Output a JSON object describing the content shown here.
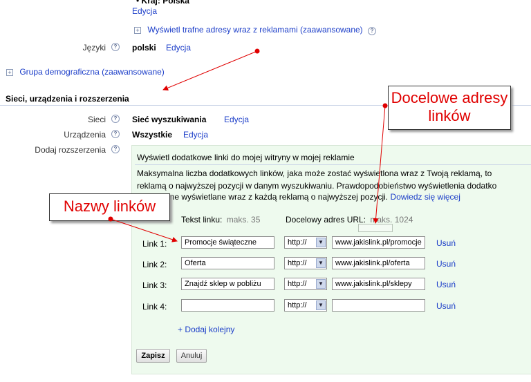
{
  "top": {
    "country_bullet": "•",
    "country_label": "Kraj: Polska",
    "edit_link": "Edycja",
    "show_urls_link": "Wyświetl trafne adresy wraz z reklamami (zaawansowane)"
  },
  "languages": {
    "label": "Języki",
    "value": "polski",
    "edit": "Edycja"
  },
  "demographics": {
    "label": "Grupa demograficzna (zaawansowane)"
  },
  "section": {
    "title": "Sieci, urządzenia i rozszerzenia"
  },
  "networks": {
    "label": "Sieci",
    "value": "Sieć wyszukiwania",
    "edit": "Edycja"
  },
  "devices": {
    "label": "Urządzenia",
    "value": "Wszystkie",
    "edit": "Edycja"
  },
  "extensions": {
    "label": "Dodaj rozszerzenia",
    "checkbox_text": "Wyświetl dodatkowe linki do mojej witryny w mojej reklamie",
    "info_line1": "Maksymalna liczba dodatkowych linków, jaka może zostać wyświetlona wraz z Twoją reklamą, to",
    "info_line2": "reklamą o najwyższej pozycji w danym wyszukiwaniu. Prawdopodobieństwo wyświetlenia dodatko",
    "info_line3": "one wyświetlane wraz z każdą reklamą o najwyższej pozycji.",
    "learn_more": "Dowiedz się więcej",
    "col_text": "Tekst linku:",
    "col_text_max": "maks. 35",
    "col_url": "Docelowy adres URL:",
    "col_url_max": "maks. 1024",
    "links": [
      {
        "label": "Link 1:",
        "text": "Promocje świąteczne",
        "protocol": "http://",
        "url": "www.jakislink.pl/promocje",
        "remove": "Usuń"
      },
      {
        "label": "Link 2:",
        "text": "Oferta",
        "protocol": "http://",
        "url": "www.jakislink.pl/oferta",
        "remove": "Usuń"
      },
      {
        "label": "Link 3:",
        "text": "Znajdź sklep w pobliżu",
        "protocol": "http://",
        "url": "www.jakislink.pl/sklepy",
        "remove": "Usuń"
      },
      {
        "label": "Link 4:",
        "text": "",
        "protocol": "http://",
        "url": "",
        "remove": "Usuń"
      }
    ],
    "add_more": "+ Dodaj kolejny",
    "save": "Zapisz",
    "cancel": "Anuluj"
  },
  "annotations": {
    "callout_urls": "Docelowe adresy linków",
    "callout_names": "Nazwy linków",
    "color": "#e00000"
  },
  "colors": {
    "link": "#1a3cc8",
    "panel_bg": "#eefaee"
  }
}
